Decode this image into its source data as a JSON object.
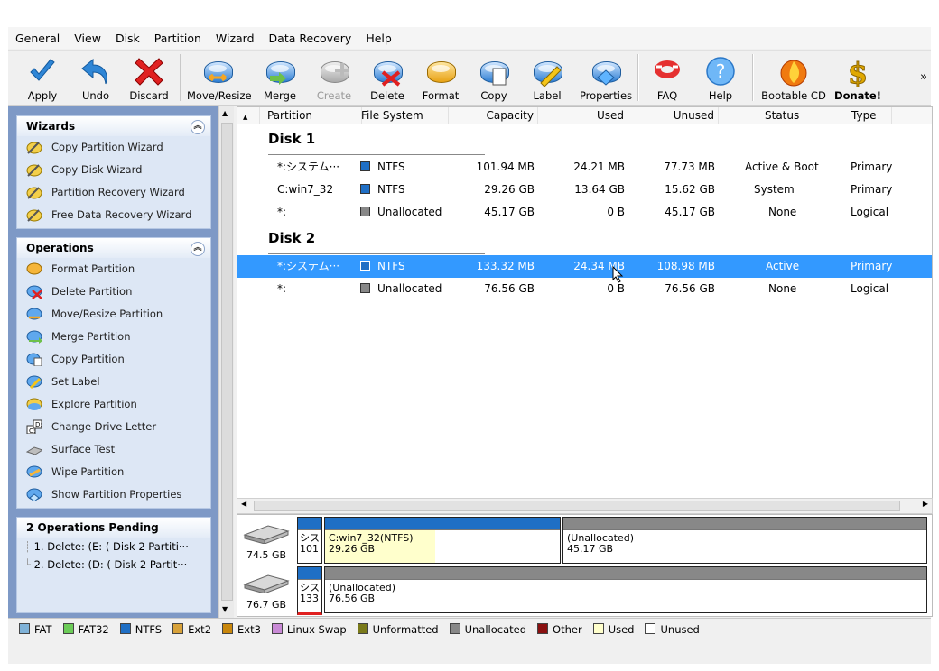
{
  "menu": [
    "General",
    "View",
    "Disk",
    "Partition",
    "Wizard",
    "Data Recovery",
    "Help"
  ],
  "toolbar": {
    "apply": "Apply",
    "undo": "Undo",
    "discard": "Discard",
    "move_resize": "Move/Resize",
    "merge": "Merge",
    "create": "Create",
    "delete": "Delete",
    "format": "Format",
    "copy": "Copy",
    "label": "Label",
    "properties": "Properties",
    "faq": "FAQ",
    "help": "Help",
    "bootable_cd": "Bootable CD",
    "donate": "Donate!",
    "more": "»"
  },
  "wizards": {
    "title": "Wizards",
    "items": [
      "Copy Partition Wizard",
      "Copy Disk Wizard",
      "Partition Recovery Wizard",
      "Free Data Recovery Wizard"
    ]
  },
  "operations": {
    "title": "Operations",
    "items": [
      "Format Partition",
      "Delete Partition",
      "Move/Resize Partition",
      "Merge Partition",
      "Copy Partition",
      "Set Label",
      "Explore Partition",
      "Change Drive Letter",
      "Surface Test",
      "Wipe Partition",
      "Show Partition Properties"
    ]
  },
  "pending": {
    "title": "2 Operations Pending",
    "items": [
      "1. Delete: (E: ( Disk 2 Partiti···",
      "2. Delete: (D: ( Disk 2 Partit···"
    ]
  },
  "columns": [
    "Partition",
    "File System",
    "Capacity",
    "Used",
    "Unused",
    "Status",
    "Type"
  ],
  "disks": [
    {
      "name": "Disk 1",
      "rows": [
        {
          "partition": "*:システム···",
          "fs": "NTFS",
          "capacity": "101.94 MB",
          "used": "24.21 MB",
          "unused": "77.73 MB",
          "status": "Active & Boot",
          "type": "Primary"
        },
        {
          "partition": "C:win7_32",
          "fs": "NTFS",
          "capacity": "29.26 GB",
          "used": "13.64 GB",
          "unused": "15.62 GB",
          "status": "System",
          "type": "Primary"
        },
        {
          "partition": "*:",
          "fs": "Unallocated",
          "capacity": "45.17 GB",
          "used": "0 B",
          "unused": "45.17 GB",
          "status": "None",
          "type": "Logical"
        }
      ]
    },
    {
      "name": "Disk 2",
      "rows": [
        {
          "partition": "*:システム···",
          "fs": "NTFS",
          "capacity": "133.32 MB",
          "used": "24.34 MB",
          "unused": "108.98 MB",
          "status": "Active",
          "type": "Primary"
        },
        {
          "partition": "*:",
          "fs": "Unallocated",
          "capacity": "76.56 GB",
          "used": "0 B",
          "unused": "76.56 GB",
          "status": "None",
          "type": "Logical"
        }
      ]
    }
  ],
  "diskmap": [
    {
      "size": "74.5 GB",
      "p1": "シス",
      "p1b": "101",
      "p2a": "C:win7_32(NTFS)",
      "p2b": "29.26 GB",
      "p3a": "(Unallocated)",
      "p3b": "45.17 GB",
      "p2_used_fraction": 0.47
    },
    {
      "size": "76.7 GB",
      "p1": "シス",
      "p1b": "133",
      "p2a": "(Unallocated)",
      "p2b": "76.56 GB"
    }
  ],
  "legend": [
    {
      "label": "FAT",
      "color": "#7fb2d8"
    },
    {
      "label": "FAT32",
      "color": "#6ccc58"
    },
    {
      "label": "NTFS",
      "color": "#1f6fc5"
    },
    {
      "label": "Ext2",
      "color": "#d8a23a"
    },
    {
      "label": "Ext3",
      "color": "#c9870c"
    },
    {
      "label": "Linux Swap",
      "color": "#c98ad6"
    },
    {
      "label": "Unformatted",
      "color": "#7a7a1a"
    },
    {
      "label": "Unallocated",
      "color": "#888888"
    },
    {
      "label": "Other",
      "color": "#8a1010"
    },
    {
      "label": "Used",
      "color": "#ffffcc"
    },
    {
      "label": "Unused",
      "color": "#ffffff"
    }
  ],
  "colors": {
    "selection": "#3399ff",
    "ntfs": "#1f6fc5",
    "unallocated": "#888888"
  }
}
